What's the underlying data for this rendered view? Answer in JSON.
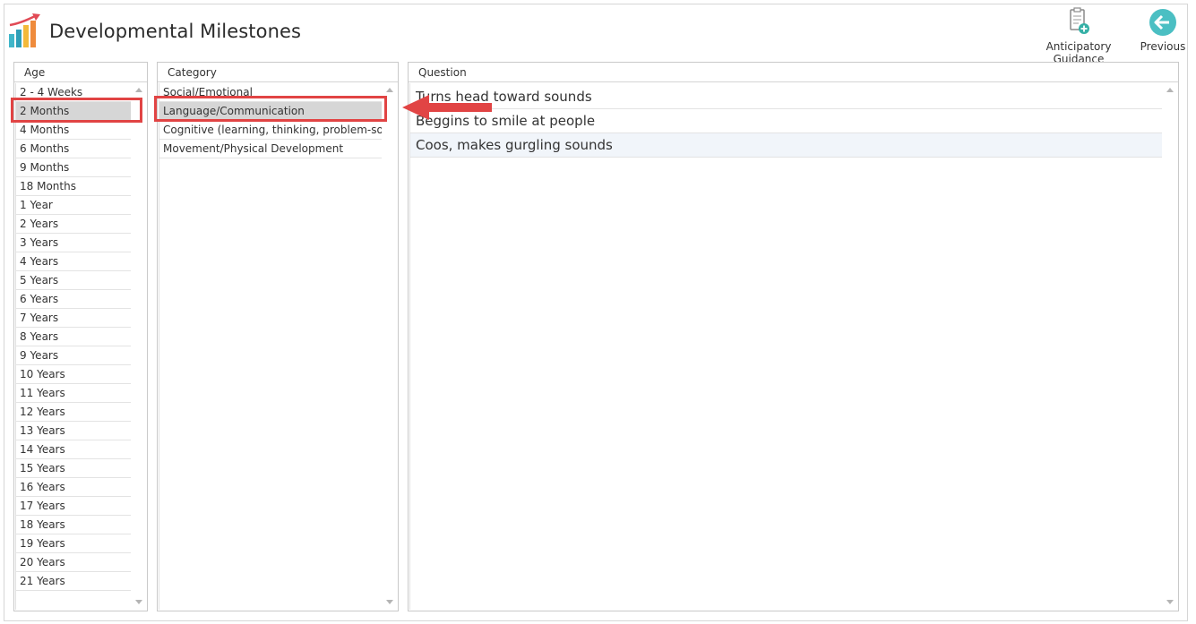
{
  "header": {
    "title": "Developmental Milestones",
    "logo_icon": "bar-chart-growth-icon",
    "actions": {
      "anticipatory_guidance_label": "Anticipatory Guidance",
      "anticipatory_guidance_icon": "document-add-icon",
      "previous_label": "Previous",
      "previous_icon": "back-arrow-icon"
    }
  },
  "age_panel": {
    "header": "Age",
    "selected": "2 Months",
    "items": [
      "2 - 4 Weeks",
      "2 Months",
      "4 Months",
      "6 Months",
      "9 Months",
      "18 Months",
      "1 Year",
      "2 Years",
      "3 Years",
      "4 Years",
      "5 Years",
      "6 Years",
      "7 Years",
      "8 Years",
      "9 Years",
      "10 Years",
      "11 Years",
      "12 Years",
      "13 Years",
      "14 Years",
      "15 Years",
      "16 Years",
      "17 Years",
      "18 Years",
      "19 Years",
      "20 Years",
      "21 Years"
    ]
  },
  "category_panel": {
    "header": "Category",
    "selected": "Language/Communication",
    "items": [
      "Social/Emotional",
      "Language/Communication",
      "Cognitive (learning, thinking, problem-solvi...",
      "Movement/Physical Development"
    ]
  },
  "question_panel": {
    "header": "Question",
    "items": [
      "Turns head toward sounds",
      "Beggins to smile at people",
      "Coos, makes gurgling sounds"
    ]
  },
  "colors": {
    "annotation_red": "#e14444",
    "selected_row": "#d6d6d6",
    "previous_button": "#4bbfc3"
  }
}
